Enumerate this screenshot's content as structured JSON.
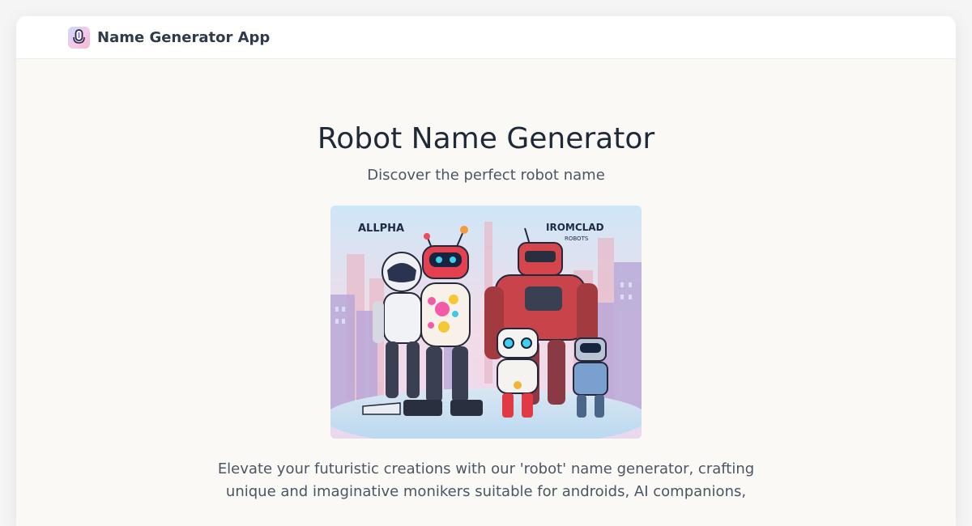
{
  "app": {
    "brand": "Name Generator App",
    "logo_icon": "microphone-app-icon"
  },
  "main": {
    "title": "Robot Name Generator",
    "subtitle": "Discover the perfect robot name",
    "hero_image": {
      "sign_left": "ALLPHA",
      "sign_right_title": "IROMCLAD",
      "sign_right_sub": "ROBOTS"
    },
    "description": "Elevate your futuristic creations with our 'robot' name generator, crafting unique and imaginative monikers suitable for androids, AI companions,"
  }
}
